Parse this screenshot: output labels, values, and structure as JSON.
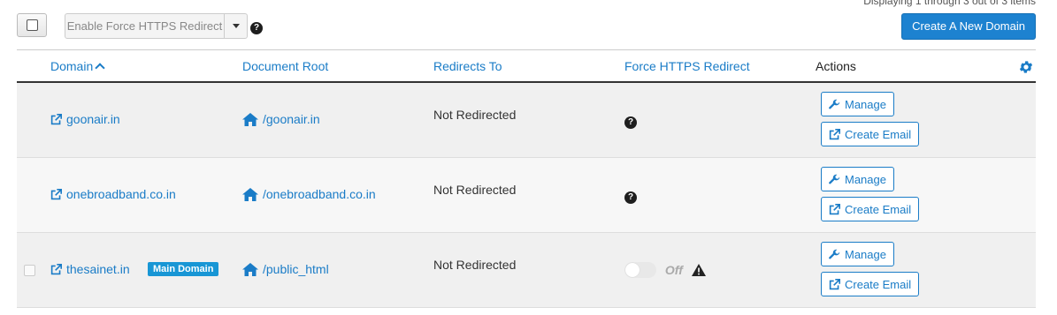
{
  "pagination": {
    "display_text": "Displaying 1 through 3 out of 3 items"
  },
  "toolbar": {
    "bulk_action_label": "Enable Force HTTPS Redirect",
    "create_button_label": "Create A New Domain"
  },
  "table": {
    "headers": {
      "domain": "Domain",
      "document_root": "Document Root",
      "redirects_to": "Redirects To",
      "force_https": "Force HTTPS Redirect",
      "actions": "Actions"
    },
    "rows": [
      {
        "domain": "goonair.in",
        "document_root": "/goonair.in",
        "redirects_to": "Not Redirected",
        "manage_label": "Manage",
        "create_email_label": "Create Email"
      },
      {
        "domain": "onebroadband.co.in",
        "document_root": "/onebroadband.co.in",
        "redirects_to": "Not Redirected",
        "manage_label": "Manage",
        "create_email_label": "Create Email"
      },
      {
        "domain": "thesainet.in",
        "badge": "Main Domain",
        "document_root": "/public_html",
        "redirects_to": "Not Redirected",
        "force_https_state": "Off",
        "manage_label": "Manage",
        "create_email_label": "Create Email"
      }
    ]
  },
  "colors": {
    "accent": "#1a7cc7",
    "primary_button": "#1d82d0",
    "badge": "#1896d5"
  },
  "icons": [
    "external-link-icon",
    "home-icon",
    "wrench-icon",
    "question-circle-icon",
    "warning-icon",
    "gear-icon",
    "sort-ascending-icon",
    "caret-down-icon"
  ]
}
